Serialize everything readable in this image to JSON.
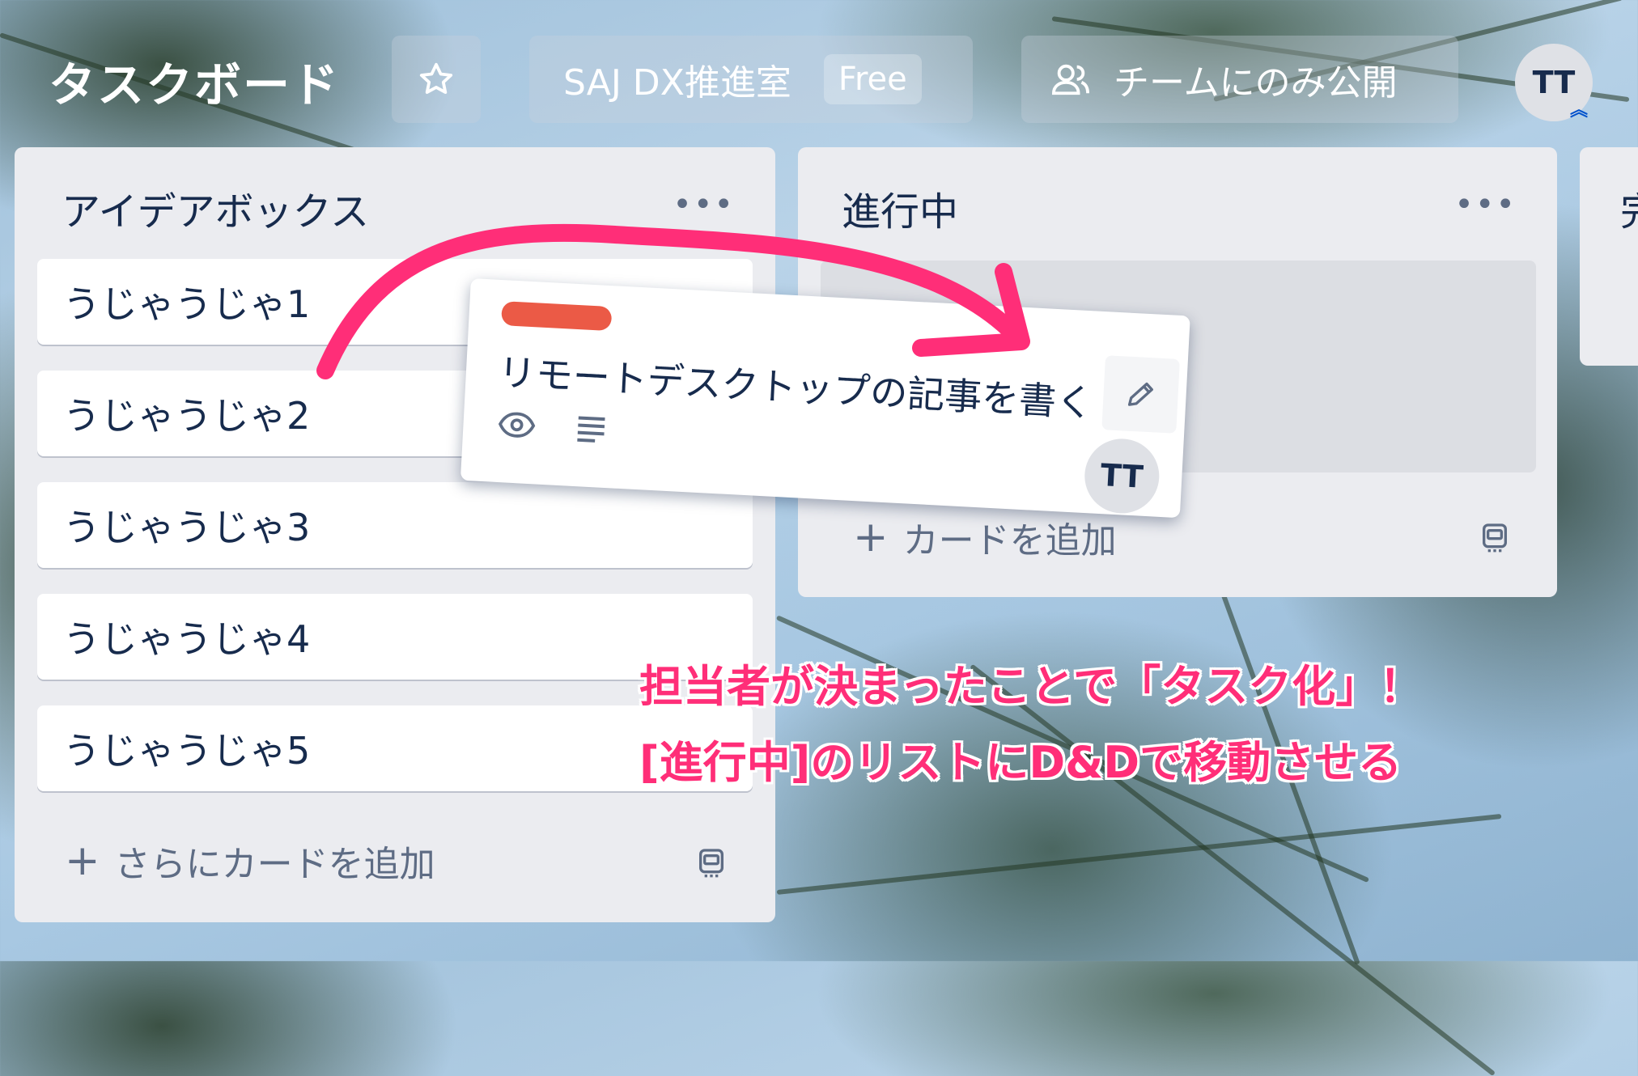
{
  "header": {
    "board_title": "タスクボード",
    "team_name": "SAJ DX推進室",
    "plan_badge": "Free",
    "visibility": "チームにのみ公開",
    "avatar_initials": "TT"
  },
  "lists": [
    {
      "title": "アイデアボックス",
      "cards": [
        "うじゃうじゃ1",
        "うじゃうじゃ2",
        "うじゃうじゃ3",
        "うじゃうじゃ4",
        "うじゃうじゃ5"
      ],
      "add_label": "さらにカードを追加"
    },
    {
      "title": "進行中",
      "add_label": "カードを追加"
    },
    {
      "title": "完"
    }
  ],
  "dragged_card": {
    "label_color": "#eb5a46",
    "title": "リモートデスクトップの記事を書く",
    "member_initials": "TT",
    "icons": [
      "eye-icon",
      "description-icon",
      "pencil-icon"
    ]
  },
  "annotation": {
    "line1": "担当者が決まったことで「タスク化」！",
    "line2": "[進行中]のリストにD&Dで移動させる",
    "color": "#ff2e78"
  }
}
